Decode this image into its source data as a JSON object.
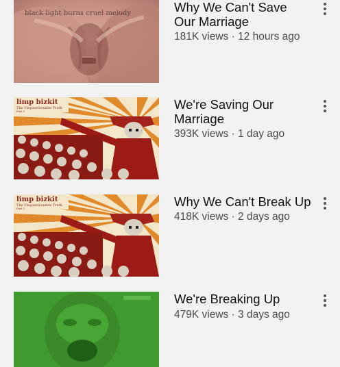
{
  "videos": [
    {
      "title": "Why We Can't Save Our Marriage",
      "views": "181K views",
      "age": "12 hours ago",
      "thumbnail_text": "black light burns  cruel melody",
      "thumbnail": "hands-over-face"
    },
    {
      "title": "We're Saving Our Marriage",
      "views": "393K views",
      "age": "1 day ago",
      "thumbnail_text": [
        "limp bizkit",
        "The Unquestionable Truth",
        "Part 1"
      ],
      "thumbnail": "skull-army-sunburst"
    },
    {
      "title": "Why We Can't Break Up",
      "views": "418K views",
      "age": "2 days ago",
      "thumbnail_text": [
        "limp bizkit",
        "The Unquestionable Truth",
        "Part 1"
      ],
      "thumbnail": "skull-army-sunburst"
    },
    {
      "title": "We're Breaking Up",
      "views": "479K views",
      "age": "3 days ago",
      "thumbnail_text": "",
      "thumbnail": "green-face"
    }
  ],
  "meta_separator": " · ",
  "menu_icon": "more-vert-icon",
  "colors": {
    "background": "#f2f2f2",
    "title_text": "#111111",
    "meta_text": "#4a4a4a",
    "sunburst_orange": "#e08a2c",
    "army_red": "#9c1b16",
    "green_thumb": "#3f9a2f"
  }
}
